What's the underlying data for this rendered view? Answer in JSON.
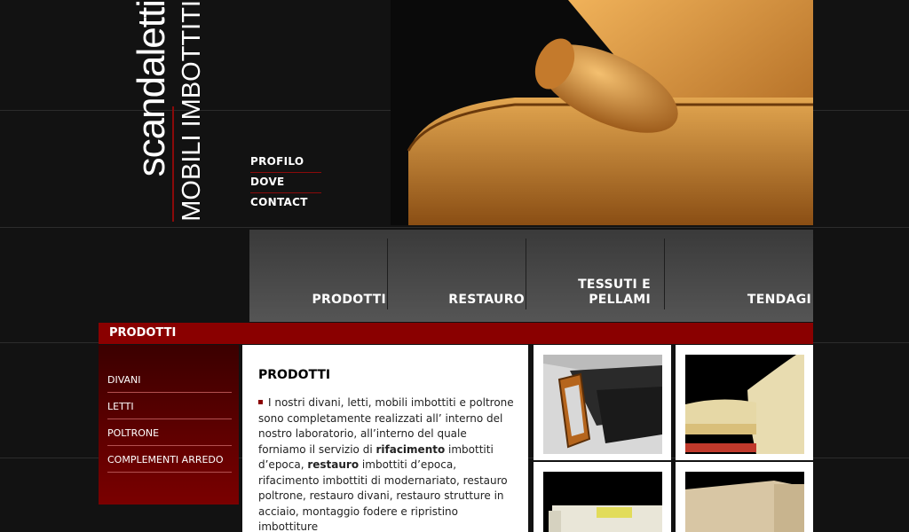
{
  "brand": {
    "name": "scandaletti",
    "subtitle": "MOBILI IMBOTTITI"
  },
  "top_nav": [
    {
      "label": "PROFILO"
    },
    {
      "label": "DOVE"
    },
    {
      "label": "CONTACT"
    }
  ],
  "main_nav": [
    {
      "label": "PRODOTTI"
    },
    {
      "label": "RESTAURO"
    },
    {
      "label": "TESSUTI E PELLAMI"
    },
    {
      "label": "TENDAGI"
    }
  ],
  "section": {
    "title": "PRODOTTI"
  },
  "sidebar": {
    "items": [
      {
        "label": "DIVANI"
      },
      {
        "label": "LETTI"
      },
      {
        "label": "POLTRONE"
      },
      {
        "label": "COMPLEMENTI ARREDO"
      }
    ]
  },
  "content": {
    "heading": "PRODOTTI",
    "text": {
      "p1": "I nostri divani, letti, mobili imbottiti e poltrone sono completamente realizzati all’ interno del nostro laboratorio, all’interno del quale forniamo il servizio di ",
      "b1": "rifacimento",
      "p2": " imbottiti d’epoca, ",
      "b2": "restauro",
      "p3": " imbottiti d’epoca, rifacimento imbottiti di modernariato, restauro poltrone, restauro divani, restauro strutture in acciaio, montaggio fodere e ripristino imbottiture"
    }
  },
  "colors": {
    "accent_red": "#8a0000",
    "background": "#121212",
    "sofa_orange": "#d9953a"
  }
}
